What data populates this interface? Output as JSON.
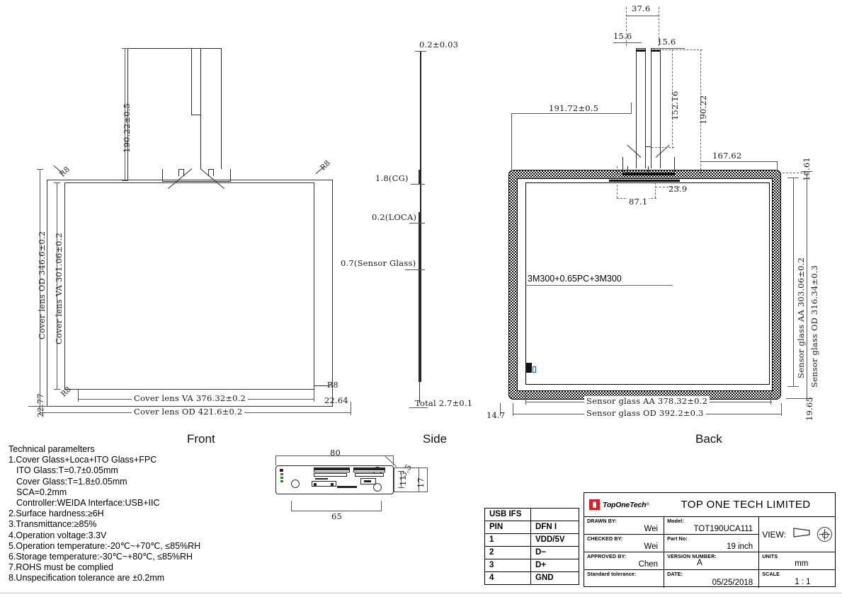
{
  "drawing": {
    "views": {
      "front": "Front",
      "side": "Side",
      "back": "Back"
    }
  },
  "front_view": {
    "dims": {
      "fpc_height": "190.22±0.5",
      "cover_lens_od_v": "Cover lens OD 346.6±0.2",
      "cover_lens_va_v": "Cover lens VA 301.06±0.2",
      "cover_lens_va_h": "Cover lens VA 376.32±0.2",
      "cover_lens_od_h": "Cover lens OD 421.6±0.2",
      "left_offset": "22.77",
      "right_offset": "22.64",
      "radius_tl": "R8",
      "radius_tr": "R8",
      "radius_bl": "R8",
      "radius_br": "R8"
    }
  },
  "side_view": {
    "dims": {
      "top": "0.2±0.03",
      "cg": "1.8(CG)",
      "loca": "0.2(LOCA)",
      "sensor_glass": "0.7(Sensor Glass)",
      "total": "Total 2.7±0.1"
    }
  },
  "back_view": {
    "dims": {
      "fpc_width_total": "37.6",
      "fpc_left": "15.6",
      "fpc_right": "15.6",
      "fpc_inner_h": "152.16",
      "fpc_outer_h": "190.22",
      "left_to_fpc": "191.72±0.5",
      "tail_base_w": "87.1",
      "tail_step": "23.9",
      "right_167": "167.62",
      "top_right_10": "10.61",
      "sensor_aa_v": "Sensor glass AA 303.06±0.2",
      "sensor_od_v": "Sensor glass OD 316.34±0.3",
      "sensor_aa_h": "Sensor glass AA 378.32±0.2",
      "sensor_od_h": "Sensor glass OD 392.2±0.3",
      "bottom_left_14": "14.7",
      "bottom_right_19": "19.65",
      "tape_note": "3M300+0.65PC+3M300"
    }
  },
  "pcb_module": {
    "dims": {
      "width": "80",
      "inner_width": "65",
      "height": "17",
      "inner_height": "11",
      "chamfer": "3.5"
    }
  },
  "notes": {
    "title": "Technical paramelters",
    "lines": [
      "1.Cover Glass+Loca+ITO Glass+FPC",
      "ITO Glass:T=0.7±0.05mm",
      "Cover Glass:T=1.8±0.05mm",
      "SCA=0.2mm",
      "Controller:WEIDA    Interface:USB+IIC",
      "2.Surface hardness:≥6H",
      "3.Transmittance:≥85%",
      "4.Operation voltage:3.3V",
      "5.Operation temperature:-20℃~+70℃, ≤85%RH",
      "6.Storage temperature:-30℃~+80℃, ≤85%RH",
      "7.ROHS must be complied",
      "8.Unspecification tolerance are ±0.2mm"
    ]
  },
  "usb_table": {
    "title": "USB IFS",
    "headers": [
      "PIN",
      "DFN I"
    ],
    "rows": [
      [
        "1",
        "VDD/5V"
      ],
      [
        "2",
        "D−"
      ],
      [
        "3",
        "D+"
      ],
      [
        "4",
        "GND"
      ]
    ]
  },
  "title_block": {
    "logo_text": "TopOneTech",
    "logo_reg": "®",
    "company": "TOP ONE TECH LIMITED",
    "fields": [
      {
        "label": "DRAWN BY:",
        "value": "Wei"
      },
      {
        "label": "CHECKED BY:",
        "value": "Wei"
      },
      {
        "label": "APPROVED BY:",
        "value": "Chen"
      },
      {
        "label": "Standard tolerance:",
        "value": ""
      }
    ],
    "fields2": [
      {
        "label": "Model:",
        "value": "TOT190UCA111"
      },
      {
        "label": "Part No:",
        "value": "19 inch"
      },
      {
        "label": "VERSION NUMBER:",
        "value": "A"
      },
      {
        "label": "DATE:",
        "value": "05/25/2018"
      }
    ],
    "view_label": "VIEW:",
    "units_label": "UNITS",
    "units_value": "mm",
    "scale_label": "SCALE",
    "scale_value": "1 : 1"
  },
  "colors": {
    "line": "#2a2a2a",
    "dim": "#555555",
    "logo_red": "#d2232a"
  }
}
